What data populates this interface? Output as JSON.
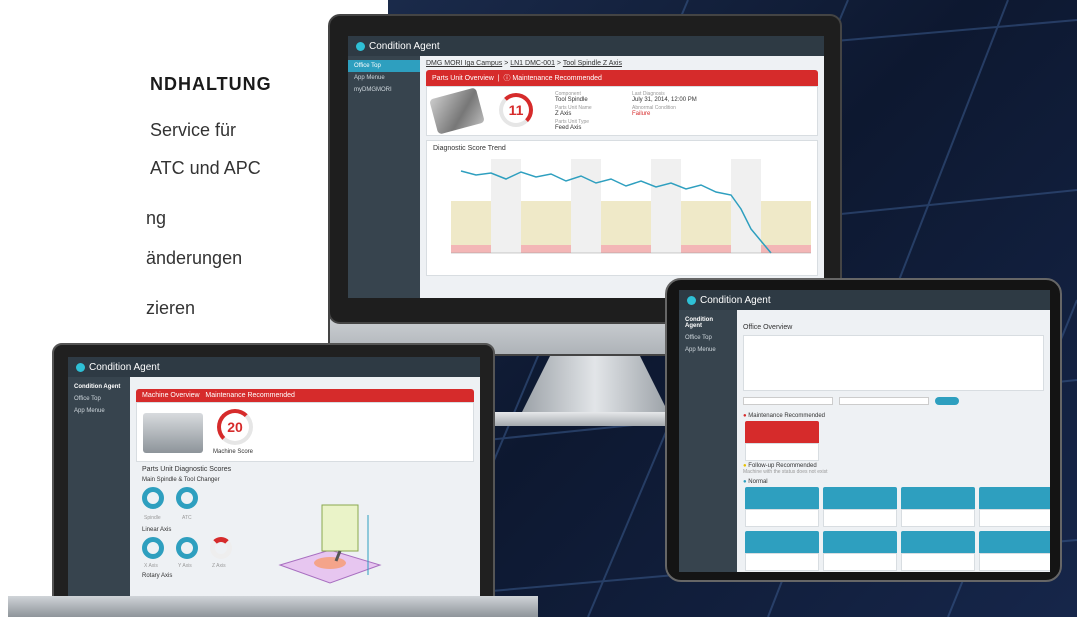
{
  "left_text": {
    "heading": "NDHALTUNG",
    "lines": [
      "Service für",
      "ATC und APC",
      "ng",
      "änderungen",
      "zieren"
    ]
  },
  "monitor": {
    "app_title": "Condition Agent",
    "sidebar": [
      "Office Top",
      "App Menue",
      "myDMGMORI"
    ],
    "breadcrumb": [
      "DMG MORI Iga Campus",
      "LN1 DMC-001",
      "Tool Spindle Z Axis"
    ],
    "banner": "Parts Unit Overview",
    "banner_alert": "Maintenance Recommended",
    "score": "11",
    "fields": [
      {
        "label": "Component",
        "value": "Tool Spindle"
      },
      {
        "label": "Last Diagnosis",
        "value": "July 31, 2014, 12:00 PM"
      },
      {
        "label": "Parts Unit Name",
        "value": "Z Axis"
      },
      {
        "label": "Abnormal Condition",
        "value": "Failure"
      },
      {
        "label": "Parts Unit Type",
        "value": "Feed Axis"
      }
    ],
    "chart_title": "Diagnostic Score Trend"
  },
  "laptop": {
    "app_title": "Condition Agent",
    "sidebar_header": "Condition Agent",
    "sidebar": [
      "Office Top",
      "App Menue"
    ],
    "banner": "Machine Overview",
    "banner_alert": "Maintenance Recommended",
    "score": "20",
    "score_label": "Machine Score",
    "section_title": "Parts Unit Diagnostic Scores",
    "groups": [
      "Main Spindle & Tool Changer",
      "Linear Axis",
      "Rotary Axis"
    ],
    "donut_labels": [
      "Spindle",
      "ATC",
      "X Axis",
      "Y Axis",
      "Z Axis"
    ]
  },
  "tablet": {
    "app_title": "Condition Agent",
    "sidebar_header": "Condition Agent",
    "sidebar": [
      "Office Top",
      "App Menue"
    ],
    "page_title": "Office Overview",
    "sections": [
      "Maintenance Recommended",
      "Follow-up Recommended",
      "Normal"
    ],
    "follow_up_text": "Machine with the status does not exist"
  },
  "colors": {
    "accent": "#2e9fbf",
    "alert": "#d62b2b",
    "sidebar": "#37444e"
  }
}
